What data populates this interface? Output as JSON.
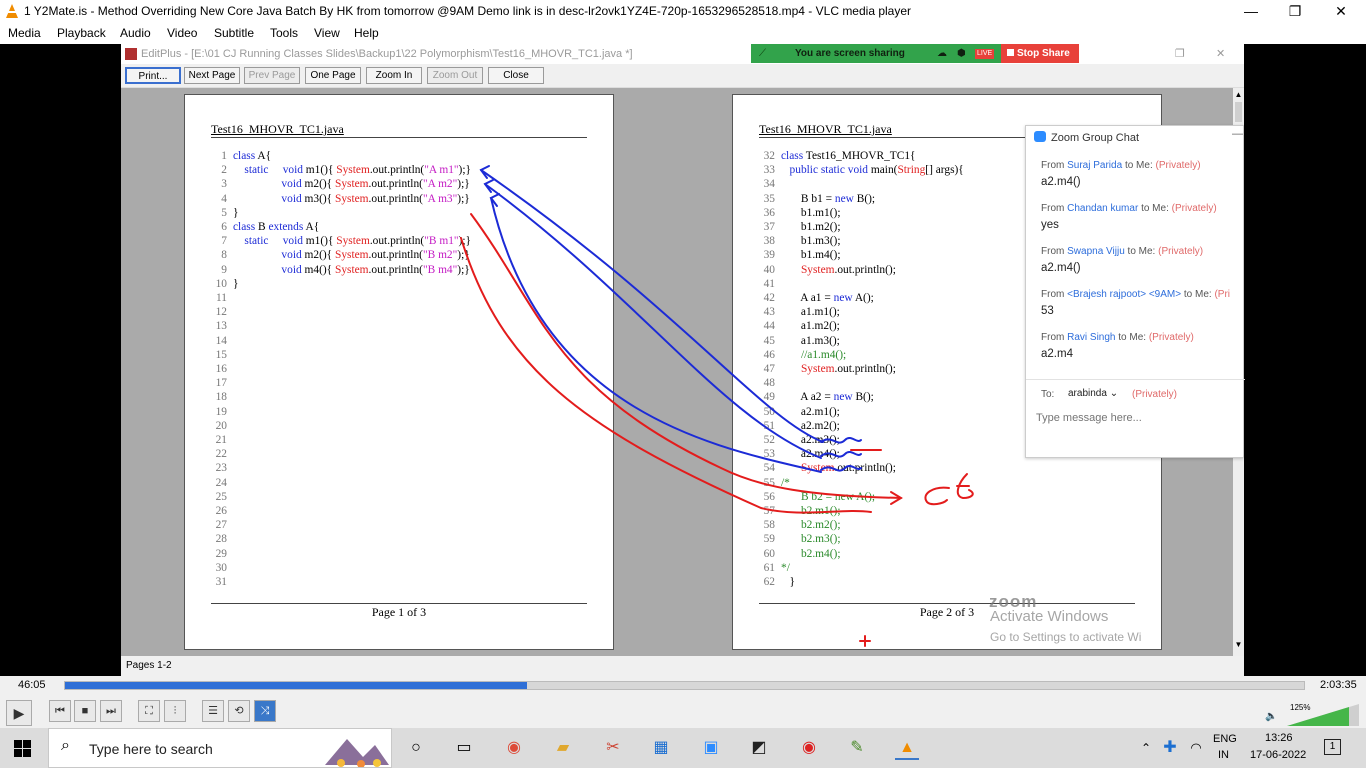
{
  "vlc": {
    "title": "1 Y2Mate.is - Method Overriding  New Core Java Batch By HK from tomorrow @9AM  Demo link is in desc-lr2ovk1YZ4E-720p-1653296528518.mp4 - VLC media player",
    "menu": [
      "Media",
      "Playback",
      "Audio",
      "Video",
      "Subtitle",
      "Tools",
      "View",
      "Help"
    ],
    "time_elapsed": "46:05",
    "time_total": "2:03:35",
    "progress": 0.373,
    "volume": "125%"
  },
  "editplus": {
    "title": "EditPlus - [E:\\01 CJ Running Classes Slides\\Backup1\\22 Polymorphism\\Test16_MHOVR_TC1.java *]",
    "toolbar": [
      {
        "label": "Print...",
        "enabled": true
      },
      {
        "label": "Next Page",
        "enabled": true
      },
      {
        "label": "Prev Page",
        "enabled": false
      },
      {
        "label": "One Page",
        "enabled": true
      },
      {
        "label": "Zoom In",
        "enabled": true
      },
      {
        "label": "Zoom Out",
        "enabled": false
      },
      {
        "label": "Close",
        "enabled": true
      }
    ],
    "status": "Pages 1-2",
    "page1": {
      "header": "Test16_MHOVR_TC1.java",
      "footer": "Page 1 of 3"
    },
    "page2": {
      "header": "Test16_MHOVR_TC1.java",
      "footer": "Page 2 of 3"
    }
  },
  "screen_share": {
    "label": "You are screen sharing",
    "live": "LIVE",
    "stop": "Stop Share"
  },
  "annotation": {
    "text": "CE"
  },
  "watermark": {
    "line1": "Activate Windows",
    "line2": "Go to Settings to activate Wi",
    "logo": "zoom"
  },
  "zoom_chat": {
    "title": "Zoom Group Chat",
    "messages": [
      {
        "from": "From",
        "name": "Suraj Parida",
        "to": "to Me:",
        "privacy": "(Privately)",
        "body": "a2.m4()"
      },
      {
        "from": "From",
        "name": "Chandan kumar",
        "to": "to Me:",
        "privacy": "(Privately)",
        "body": "yes"
      },
      {
        "from": "From",
        "name": "Swapna Vijju",
        "to": "to Me:",
        "privacy": "(Privately)",
        "body": "a2.m4()"
      },
      {
        "from": "From",
        "name": "<Brajesh rajpoot> <9AM>",
        "to": "to Me:",
        "privacy": "(Pri",
        "body": "53"
      },
      {
        "from": "From",
        "name": "Ravi Singh",
        "to": "to Me:",
        "privacy": "(Privately)",
        "body": "a2.m4"
      }
    ],
    "to_label": "To:",
    "to_value": "arabinda",
    "to_privacy": "(Privately)",
    "input_placeholder": "Type message here..."
  },
  "taskbar": {
    "search_placeholder": "Type here to search",
    "lang1": "ENG",
    "lang2": "IN",
    "time": "13:26",
    "date": "17-06-2022",
    "notifications": "1"
  },
  "colors": {
    "keyword": "#1d2bd6",
    "string": "#c41cc4",
    "system": "#e02020",
    "comment": "#2a8a2a",
    "share_green": "#32a34b",
    "stop_red": "#e8413a"
  }
}
